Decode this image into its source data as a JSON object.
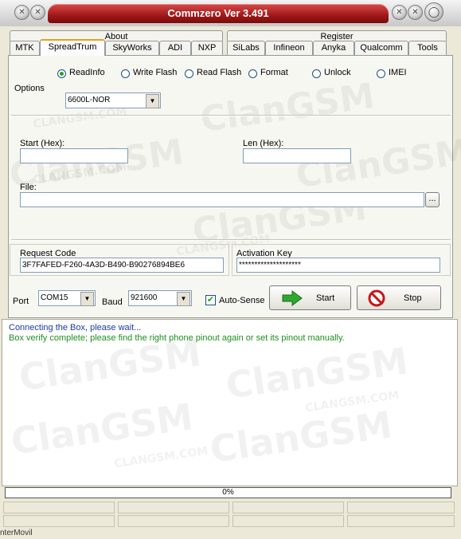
{
  "window": {
    "title": "Commzero Ver 3.491"
  },
  "tab_groups": {
    "about": "About",
    "register": "Register"
  },
  "tabs": [
    {
      "label": "MTK"
    },
    {
      "label": "SpreadTrum"
    },
    {
      "label": "SkyWorks"
    },
    {
      "label": "ADI"
    },
    {
      "label": "NXP"
    },
    {
      "label": "SiLabs"
    },
    {
      "label": "Infineon"
    },
    {
      "label": "Anyka"
    },
    {
      "label": "Qualcomm"
    },
    {
      "label": "Tools"
    }
  ],
  "active_tab": "SpreadTrum",
  "operations": [
    {
      "label": "ReadInfo",
      "selected": true
    },
    {
      "label": "Write Flash",
      "selected": false
    },
    {
      "label": "Read Flash",
      "selected": false
    },
    {
      "label": "Format",
      "selected": false
    },
    {
      "label": "Unlock",
      "selected": false
    },
    {
      "label": "IMEI",
      "selected": false
    }
  ],
  "options": {
    "label": "Options",
    "model_value": "6600L-NOR"
  },
  "start_hex": {
    "label": "Start (Hex):",
    "value": ""
  },
  "len_hex": {
    "label": "Len (Hex):",
    "value": ""
  },
  "file": {
    "label": "File:",
    "value": "",
    "browse_label": "..."
  },
  "request_code": {
    "label": "Request Code",
    "value": "3F7FAFED-F260-4A3D-B490-B90276894BE6"
  },
  "activation_key": {
    "label": "Activation Key",
    "value": "********************"
  },
  "port": {
    "label": "Port",
    "value": "COM15"
  },
  "baud": {
    "label": "Baud",
    "value": "921600"
  },
  "auto_sense": {
    "label": "Auto-Sense",
    "checked": true
  },
  "start_button": {
    "label": "Start"
  },
  "stop_button": {
    "label": "Stop"
  },
  "log": [
    {
      "text": "Connecting the Box, please wait...",
      "color": "#1a3aa6"
    },
    {
      "text": "Box verify complete; please find the right phone pinout again or set its pinout manually.",
      "color": "#1d8f1d"
    }
  ],
  "progress": {
    "value": 0,
    "text": "0%"
  },
  "footer_text": "nterMovil",
  "watermark": "ClanGSM",
  "watermark_small": "CLANGSM.COM",
  "colors": {
    "title_red": "#a01818",
    "tab_highlight": "#e6a31a",
    "log_blue": "#1a3aa6",
    "log_green": "#1d8f1d"
  }
}
